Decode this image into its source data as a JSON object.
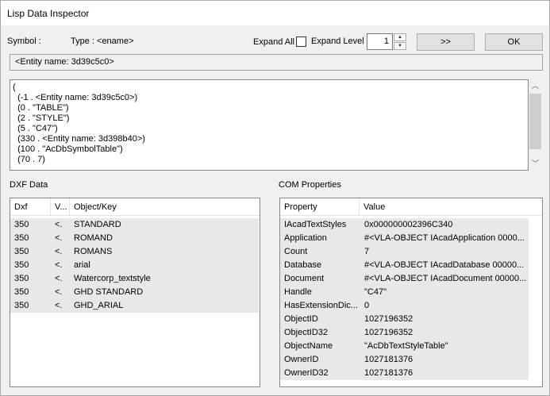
{
  "window": {
    "title": "Lisp Data Inspector"
  },
  "toolbar": {
    "symbol_label": "Symbol :",
    "type_label": "Type : <ename>",
    "expand_all_label": "Expand All",
    "expand_all_checked": false,
    "expand_level_label": "Expand Level",
    "expand_level_value": "1",
    "next_button": ">>",
    "ok_button": "OK"
  },
  "entity_field": {
    "value": "<Entity name: 3d39c5c0>"
  },
  "lisp_text": {
    "lines": [
      "(",
      "  (-1 . <Entity name: 3d39c5c0>)",
      "  (0 . \"TABLE\")",
      "  (2 . \"STYLE\")",
      "  (5 . \"C47\")",
      "  (330 . <Entity name: 3d398b40>)",
      "  (100 . \"AcDbSymbolTable\")",
      "  (70 . 7)"
    ]
  },
  "dxf_panel": {
    "title": "DXF Data",
    "columns": [
      "Dxf",
      "V...",
      "Object/Key"
    ],
    "rows": [
      {
        "dxf": "350",
        "v": "<.",
        "key": "STANDARD"
      },
      {
        "dxf": "350",
        "v": "<.",
        "key": "ROMAND"
      },
      {
        "dxf": "350",
        "v": "<.",
        "key": "ROMANS"
      },
      {
        "dxf": "350",
        "v": "<.",
        "key": "arial"
      },
      {
        "dxf": "350",
        "v": "<.",
        "key": "Watercorp_textstyle"
      },
      {
        "dxf": "350",
        "v": "<.",
        "key": "GHD STANDARD"
      },
      {
        "dxf": "350",
        "v": "<.",
        "key": "GHD_ARIAL"
      }
    ]
  },
  "com_panel": {
    "title": "COM Properties",
    "columns": [
      "Property",
      "Value"
    ],
    "rows": [
      {
        "property": "IAcadTextStyles",
        "value": "0x000000002396C340"
      },
      {
        "property": "Application",
        "value": "#<VLA-OBJECT IAcadApplication 0000..."
      },
      {
        "property": "Count",
        "value": "7"
      },
      {
        "property": "Database",
        "value": "#<VLA-OBJECT IAcadDatabase 00000..."
      },
      {
        "property": "Document",
        "value": "#<VLA-OBJECT IAcadDocument 00000..."
      },
      {
        "property": "Handle",
        "value": "\"C47\""
      },
      {
        "property": "HasExtensionDic...",
        "value": "0"
      },
      {
        "property": "ObjectID",
        "value": "1027196352"
      },
      {
        "property": "ObjectID32",
        "value": "1027196352"
      },
      {
        "property": "ObjectName",
        "value": "\"AcDbTextStyleTable\""
      },
      {
        "property": "OwnerID",
        "value": "1027181376"
      },
      {
        "property": "OwnerID32",
        "value": "1027181376"
      }
    ]
  },
  "icons": {
    "scroll_up": "chevron-up-icon",
    "scroll_down": "chevron-down-icon",
    "spin_up": "triangle-up-icon",
    "spin_down": "triangle-down-icon"
  }
}
